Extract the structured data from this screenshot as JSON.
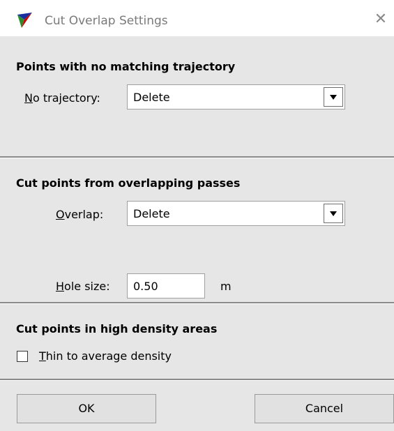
{
  "window": {
    "title": "Cut Overlap Settings",
    "close_glyph": "✕",
    "app_icon": "triangle-logo-icon"
  },
  "trajectory_section": {
    "title": "Points with no matching trajectory",
    "label_mnemonic": "N",
    "label_rest": "o trajectory:",
    "value": "Delete"
  },
  "overlap_section": {
    "title": "Cut points from overlapping passes",
    "overlap_label_mnemonic": "O",
    "overlap_label_rest": "verlap:",
    "overlap_value": "Delete",
    "hole_label_mnemonic": "H",
    "hole_label_rest": "ole size:",
    "hole_value": "0.50",
    "hole_unit": "m"
  },
  "density_section": {
    "title": "Cut points in high density areas",
    "checkbox_mnemonic": "T",
    "checkbox_rest": "hin to average density",
    "checked": false
  },
  "buttons": {
    "ok": "OK",
    "cancel": "Cancel"
  },
  "colors": {
    "dialog_bg": "#e6e6e6",
    "title_text": "#7a7a7a",
    "divider": "#8a8a8a"
  }
}
